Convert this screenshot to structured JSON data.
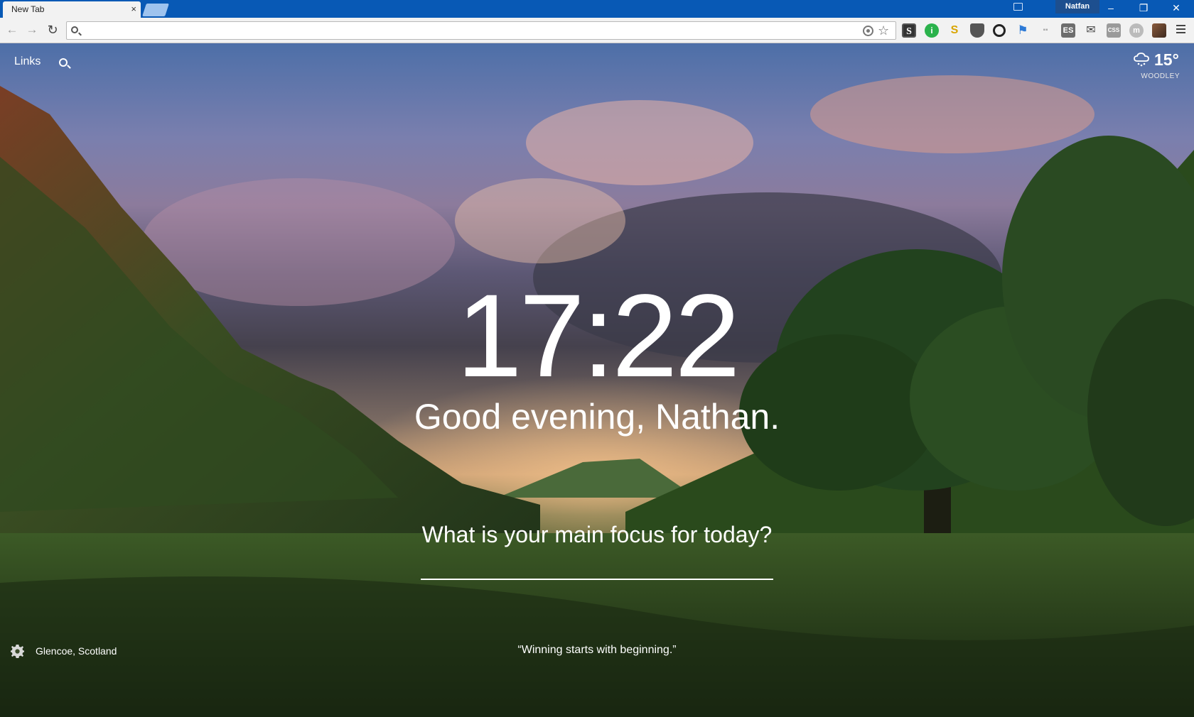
{
  "browser": {
    "tab_title": "New Tab",
    "tab_close": "×",
    "profile_name": "Natfan",
    "window_controls": {
      "minimize": "–",
      "maximize": "❐",
      "close": "✕"
    },
    "nav": {
      "back": "←",
      "forward": "→",
      "reload": "↻"
    },
    "address": {
      "value": "",
      "placeholder": ""
    },
    "star": "☆",
    "extensions": [
      {
        "name": "s-extension",
        "glyph": "S"
      },
      {
        "name": "i-extension",
        "glyph": "i"
      },
      {
        "name": "slack-extension",
        "glyph": "S"
      },
      {
        "name": "shield-extension",
        "glyph": ""
      },
      {
        "name": "ring-extension",
        "glyph": ""
      },
      {
        "name": "flag-extension",
        "glyph": "⚑"
      },
      {
        "name": "grey-extension",
        "glyph": "▪▪"
      },
      {
        "name": "es-extension",
        "glyph": "ES"
      },
      {
        "name": "mail-extension",
        "glyph": "✉"
      },
      {
        "name": "css-extension",
        "glyph": "CSS"
      },
      {
        "name": "m-extension",
        "glyph": "m"
      }
    ],
    "colors": {
      "titlebar": "#0859b5",
      "toolbar": "#f2f2f2"
    }
  },
  "momentum": {
    "links_label": "Links",
    "weather": {
      "temperature": "15°",
      "location": "WOODLEY",
      "icon": "cloud-snow-icon"
    },
    "clock": "17:22",
    "greeting": "Good evening, Nathan.",
    "focus_question": "What is your main focus for today?",
    "focus_value": "",
    "photo_location": "Glencoe, Scotland",
    "quote": "“Winning starts with beginning.”"
  }
}
